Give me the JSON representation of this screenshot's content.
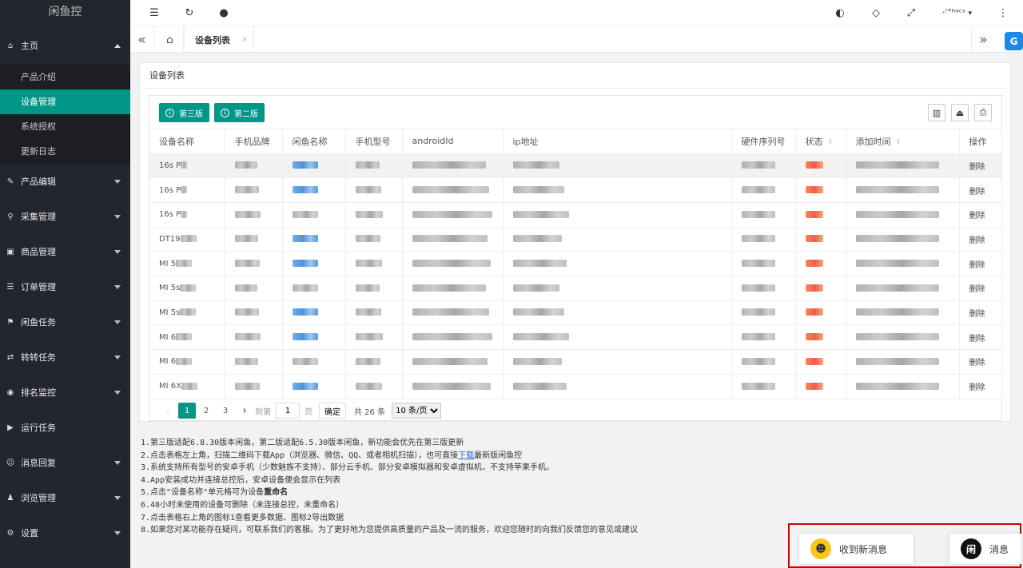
{
  "sidebar": {
    "logo": "闲鱼控",
    "home": "主页",
    "home_sub": [
      "产品介绍",
      "设备管理",
      "系统授权",
      "更新日志"
    ],
    "items": [
      {
        "label": "产品编辑",
        "icon": "edit-icon"
      },
      {
        "label": "采集管理",
        "icon": "crawler-icon"
      },
      {
        "label": "商品管理",
        "icon": "goods-icon"
      },
      {
        "label": "订单管理",
        "icon": "order-icon"
      },
      {
        "label": "闲鱼任务",
        "icon": "flag-icon"
      },
      {
        "label": "转转任务",
        "icon": "transfer-icon"
      },
      {
        "label": "排名监控",
        "icon": "monitor-icon"
      },
      {
        "label": "运行任务",
        "icon": "play-icon"
      },
      {
        "label": "消息回复",
        "icon": "message-icon"
      },
      {
        "label": "浏览管理",
        "icon": "user-icon"
      },
      {
        "label": "设置",
        "icon": "gear-icon"
      }
    ]
  },
  "topbar": {
    "user_name": "·ꜝ°ʰᵊᶜˢ"
  },
  "tabs": {
    "active": "设备列表",
    "close": "×"
  },
  "main": {
    "title": "设备列表",
    "btn_v3": "第三版",
    "btn_v2": "第二版",
    "columns": [
      "设备名称",
      "手机品牌",
      "闲鱼名称",
      "手机型号",
      "androidId",
      "ip地址",
      "硬件序列号",
      "状态",
      "添加时间",
      "操作"
    ],
    "rows": [
      {
        "name": "16s P",
        "action": "删除"
      },
      {
        "name": "16s P",
        "action": "删除"
      },
      {
        "name": "16s P",
        "action": "删除"
      },
      {
        "name": "DT19",
        "action": "删除"
      },
      {
        "name": "MI 5",
        "action": "删除"
      },
      {
        "name": "MI 5s",
        "action": "删除"
      },
      {
        "name": "MI 5s",
        "action": "删除"
      },
      {
        "name": "MI 6",
        "action": "删除"
      },
      {
        "name": "MI 6",
        "action": "删除"
      },
      {
        "name": "MI 6X",
        "action": "删除"
      }
    ]
  },
  "pager": {
    "pages": [
      "1",
      "2",
      "3"
    ],
    "goto_label": "到第",
    "goto_value": "1",
    "page_unit": "页",
    "confirm": "确定",
    "total": "共 26 条",
    "page_size": "10 条/页"
  },
  "notes": {
    "n1": "1.第三版适配6.8.30版本闲鱼，第二版适配6.5.30版本闲鱼，新功能会优先在第三版更新",
    "n2a": "2.点击表格左上角，扫描二维码下载App（浏览器、微信、QQ、或者相机扫描），也可直接",
    "n2link": "下载",
    "n2b": "最新版闲鱼控",
    "n3": "3.系统支持所有型号的安卓手机（少数魅族不支持）、部分云手机、部分安卓模拟器和安卓虚拟机，不支持苹果手机。",
    "n4": "4.App安装成功并连接总控后，安卓设备便会显示在列表",
    "n5a": "5.点击\"设备名称\"单元格可为设备",
    "n5b": "重命名",
    "n6": "6.48小时未使用的设备可删除（未连接总控，未重命名）",
    "n7": "7.点击表格右上角的图标1查看更多数据、图标2导出数据",
    "n8": "8.如果您对某功能存在疑问，可联系我们的客服。为了更好地为您提供高质量的产品及一流的服务，欢迎您随时的向我们反馈您的意见或建议"
  },
  "notify": {
    "new_msg": "收到新消息",
    "msg": "消息",
    "msg_avatar": "闲"
  },
  "colors": {
    "accent": "#009688",
    "sidebar": "#23262e",
    "notify_border": "#cc0000"
  }
}
